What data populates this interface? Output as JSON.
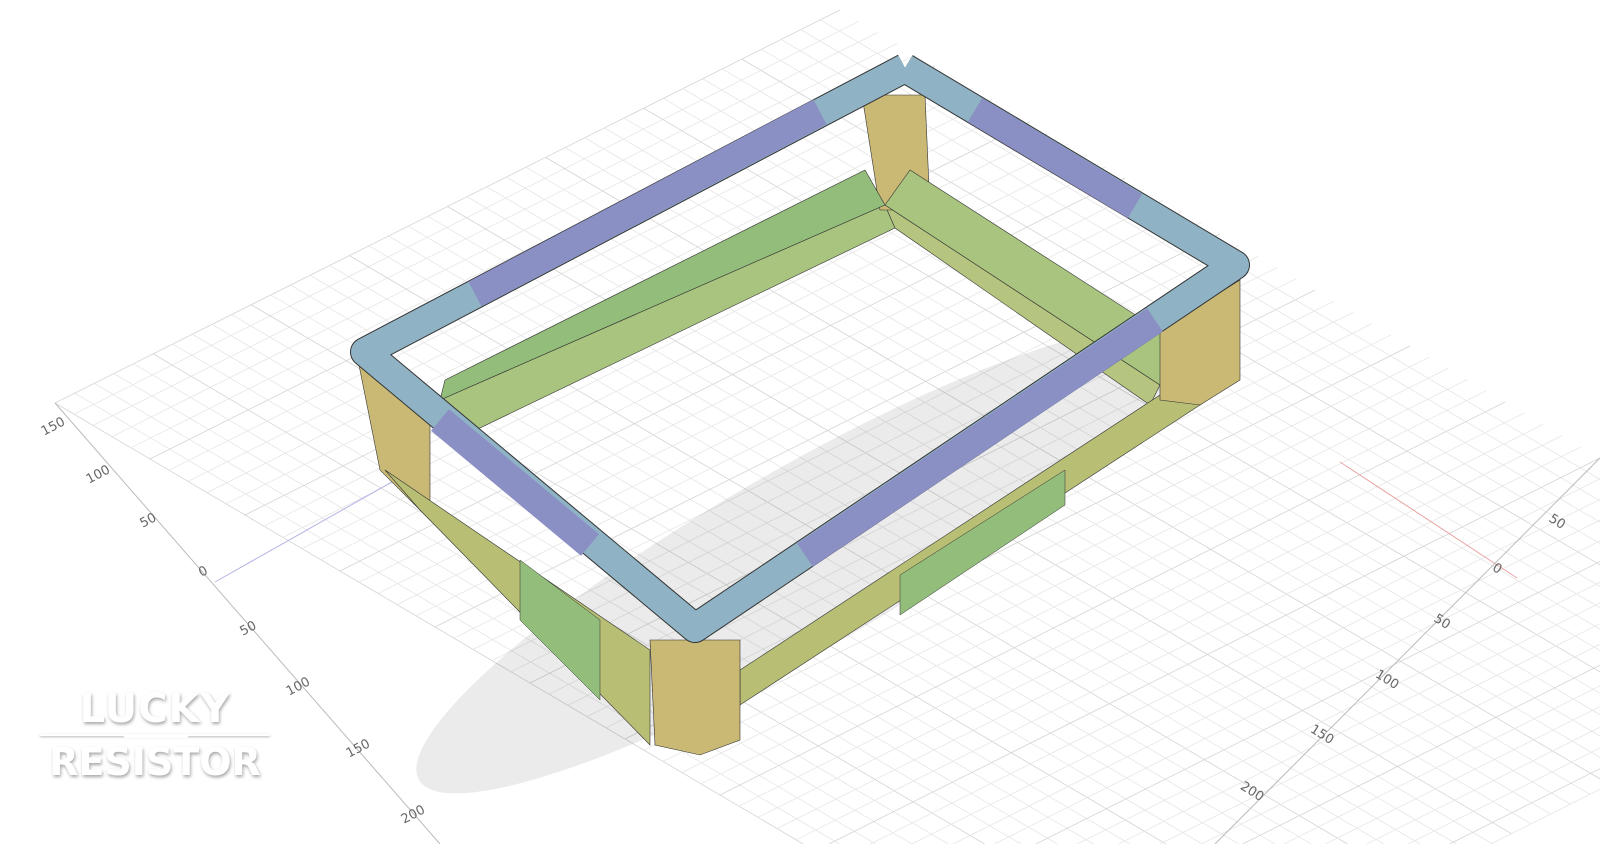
{
  "viewport": {
    "left_axis_labels": [
      "150",
      "100",
      "50",
      "0",
      "50",
      "100",
      "150",
      "200"
    ],
    "right_axis_labels": [
      "50",
      "0",
      "50",
      "100",
      "150",
      "200"
    ]
  },
  "colors": {
    "rim": "#8fb3c4",
    "rim_purple": "#8a8fc4",
    "wall_yellow": "#c9b975",
    "wall_green": "#93bd7a",
    "grid": "#e6e6e6",
    "grid_major": "#d4d4d4",
    "x_axis": "#e9a3a3",
    "y_axis": "#b3b3e6"
  },
  "logo": {
    "line1": "LUCKY",
    "line2": "RESISTOR"
  }
}
